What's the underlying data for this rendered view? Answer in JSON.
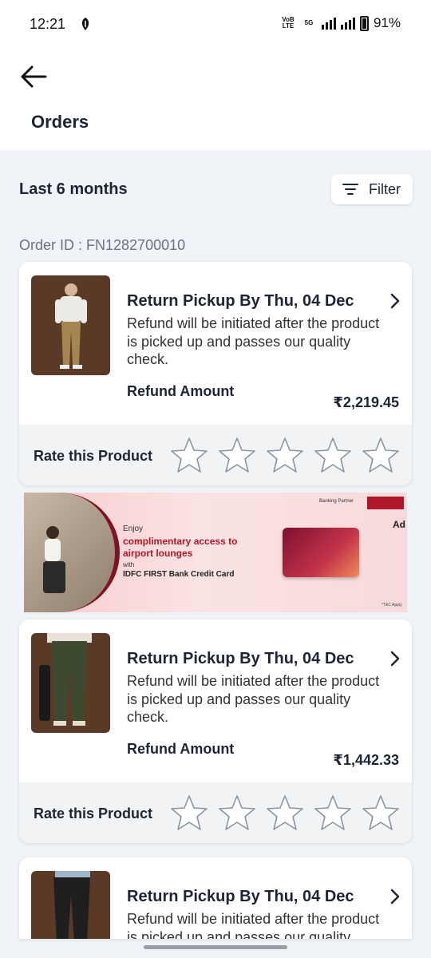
{
  "status_bar": {
    "time": "12:21",
    "network_a": "VoB LTE",
    "network_b": "5G",
    "battery": "91%"
  },
  "header": {
    "title": "Orders"
  },
  "period_label": "Last 6 months",
  "filter_label": "Filter",
  "order_id": "Order ID : FN1282700010",
  "orders": [
    {
      "title": "Return Pickup By Thu, 04 Dec",
      "description": "Refund will be initiated after the product is picked up and passes our quality check.",
      "refund_label": "Refund Amount",
      "refund_amount": "₹2,219.45",
      "rate_label": "Rate this Product",
      "rating": 0
    },
    {
      "title": "Return Pickup By Thu, 04 Dec",
      "description": "Refund will be initiated after the product is picked up and passes our quality check.",
      "refund_label": "Refund Amount",
      "refund_amount": "₹1,442.33",
      "rate_label": "Rate this Product",
      "rating": 0
    },
    {
      "title": "Return Pickup By Thu, 04 Dec",
      "description": "Refund will be initiated after the product is picked up and passes our quality check."
    }
  ],
  "ad": {
    "enjoy": "Enjoy",
    "headline": "complimentary access to airport lounges",
    "with": "with",
    "bank": "IDFC FIRST Bank Credit Card",
    "partner": "Banking Partner",
    "ad_mark": "Ad",
    "tc": "*T&C Apply"
  }
}
